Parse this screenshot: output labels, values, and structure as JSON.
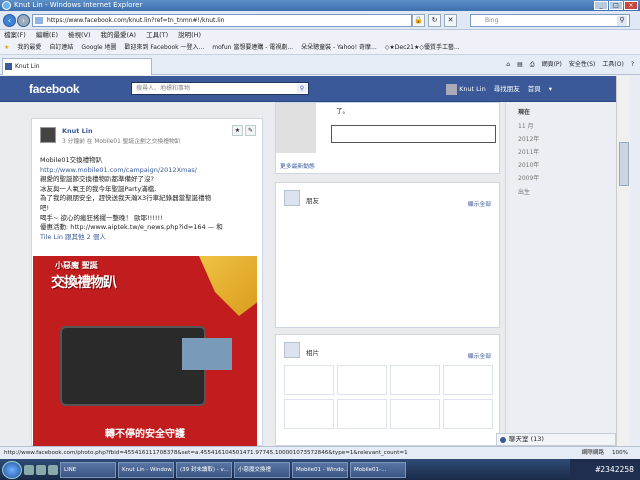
{
  "window": {
    "title": "Knut Lin - Windows Internet Explorer"
  },
  "address": {
    "url": "https://www.facebook.com/knut.lin?ref=tn_tnmn#!/knut.lin",
    "search_placeholder": "Bing"
  },
  "menu": [
    "檔案(F)",
    "編輯(E)",
    "檢視(V)",
    "我的最愛(A)",
    "工具(T)",
    "說明(H)"
  ],
  "favorites": [
    "我的最愛",
    "自訂連結",
    "Google 地圖",
    "歡迎來到 Facebook 一登入...",
    "mofun 當想要連購 - 電視劇...",
    "朵朵聰童裝 - Yahoo! 奇摩...",
    "◇★Dec21★◇優質手工藝..."
  ],
  "tab": {
    "label": "Knut Lin"
  },
  "commands": [
    "網頁(P)",
    "安全性(S)",
    "工具(O)"
  ],
  "facebook": {
    "logo": "facebook",
    "search_placeholder": "搜尋人、地標和事物",
    "user": "Knut Lin",
    "find_friends": "尋找朋友",
    "home": "首頁"
  },
  "post": {
    "author": "Knut Lin",
    "meta": "3 分鐘前 在 Mobile01 聖誕企劃之交換禮物趴",
    "lines": [
      "Mobile01交換禮物趴",
      "http://www.mobile01.com/campaign/2012Xmas/",
      "親愛的聖誕節交換禮物趴都準備好了沒?",
      "冰友與一人氧王的我今年聖誕Party滿檔,",
      "為了我的親朋安全，趕快送我天瀚X3行車紀錄器當聖誕禮物",
      "吧!",
      "喝手~ 欲心的瘋狂搖擺一整晚！ 歐耶!!!!!!",
      "優惠活動: http://www.aiptek.tw/e_news.php?id=164 — 和",
      "Tile Lin 跟其他 2 個人"
    ],
    "image_title_small": "小惡魔 聖誕",
    "image_title_big": "交換禮物趴",
    "image_bottom": "轉不停的安全守護"
  },
  "mid": {
    "top_snippet": "了。",
    "more_updates": "更多最新動態",
    "friends_title": "朋友",
    "friends_more": "顯示全部",
    "photos_title": "相片",
    "photos_more": "顯示全部"
  },
  "timeline": [
    "現在",
    "11 月",
    "2012年",
    "2011年",
    "2010年",
    "2009年",
    "出生"
  ],
  "chat": {
    "label": "聊天室 (13)"
  },
  "statusbar": {
    "link": "http://www.facebook.com/photo.php?fbid=455416111708378&set=a.455416104501471.97745.100001073572846&type=1&relevant_count=1",
    "zone": "網際網路",
    "zoom": "100%"
  },
  "taskbar": [
    "LINE",
    "Knut Lin - Window...",
    "(39 封未讀取) - v...",
    "小惡魔交換禮",
    "Mobile01 - Windo...",
    "Mobile01-..."
  ],
  "watermark": "#2342258"
}
